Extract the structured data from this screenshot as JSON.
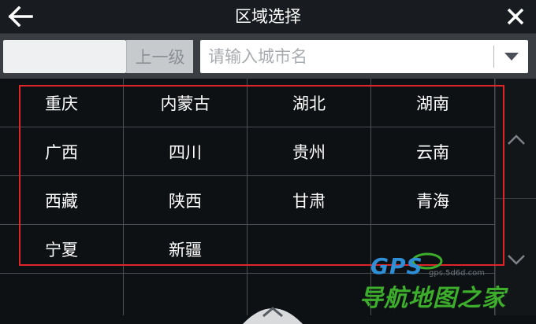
{
  "header": {
    "title": "区域选择"
  },
  "toolbar": {
    "up_label": "上一级",
    "search_placeholder": "请输入城市名",
    "search_value": ""
  },
  "regions": [
    "重庆",
    "内蒙古",
    "湖北",
    "湖南",
    "广西",
    "四川",
    "贵州",
    "云南",
    "西藏",
    "陕西",
    "甘肃",
    "青海",
    "宁夏",
    "新疆"
  ],
  "watermark": {
    "logo": "GPS",
    "url": "gps.5d6d.com",
    "brand": "导航地图之家"
  },
  "colors": {
    "background": "#0d1114",
    "highlight": "#e0252a",
    "grid_line": "#4a4f55"
  },
  "icons": {
    "back": "arrow-left-icon",
    "close": "close-icon",
    "dropdown": "caret-down-icon",
    "scroll_up": "chevron-up-icon",
    "scroll_down": "chevron-down-icon"
  }
}
